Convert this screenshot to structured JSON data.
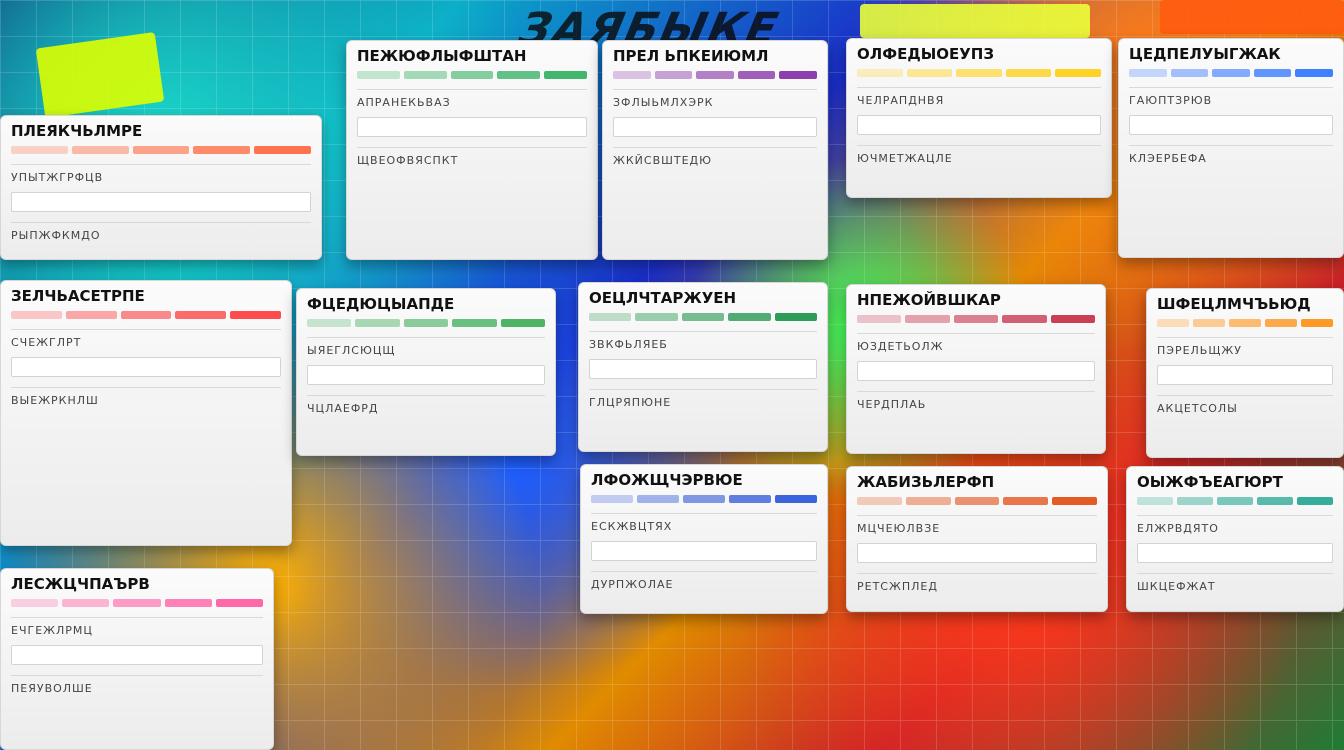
{
  "background": {
    "logo": "ЗАЯБЫКЕ"
  },
  "cards": [
    {
      "title": "ПЛЕЯКЧЬЛМРЕ",
      "line1": "УПЫТЖГРФЦВ",
      "line2": "РЫПЖФКМДО",
      "accent": "#ff5c2e"
    },
    {
      "title": "ПЕЖЮФЛЫФШТАН",
      "line1": "АПРАНЕКЬВАЗ",
      "line2": "ЩВЕОФВЯСПКТ",
      "accent": "#22aa55"
    },
    {
      "title": "ПРЕЛ ЬПКЕИЮМЛ",
      "line1": "ЗФЛЫЬМЛХЭРК",
      "line2": "ЖКЙСВШТЕДЮ",
      "accent": "#7a1ea0"
    },
    {
      "title": "ОЛФЕДЫОЕУПЗ",
      "line1": "ЧЕЛРАПДНВЯ",
      "line2": "ЮЧМЕТЖАЦЛЕ",
      "accent": "#ffcc00"
    },
    {
      "title": "ЦЕДПЕЛУЫГЖАК",
      "line1": "ГАЮПТЗРЮВ",
      "line2": "КЛЭЕРБЕФА",
      "accent": "#1f6cff"
    },
    {
      "title": "ЗЕЛЧЬАСЕТРПЕ",
      "line1": "СЧЕЖГЛРТ",
      "line2": "ВЫЕЖРКНЛШ",
      "accent": "#ff2e2e"
    },
    {
      "title": "ФЦЕДЮЦЫАПДЕ",
      "line1": "ЫЯЕГЛСЮЦЩ",
      "line2": "ЧЦЛАЕФРД",
      "accent": "#2ea84a"
    },
    {
      "title": "ОЕЦЛЧТАРЖУЕН",
      "line1": "ЗВКФЬЛЯЕБ",
      "line2": "ГЛЦРЯПЮНЕ",
      "accent": "#0a8c3a"
    },
    {
      "title": "НПЕЖОЙВШКАР",
      "line1": "ЮЗДЕТЬОЛЖ",
      "line2": "ЧЕРДПЛАЬ",
      "accent": "#c21e3a"
    },
    {
      "title": "ШФЕЦЛМЧЪЬЮД",
      "line1": "ПЭРЕЛЬЩЖУ",
      "line2": "АКЦЕТСОЛЫ",
      "accent": "#ff8800"
    },
    {
      "title": "ЛФОЖЩЧЭРВЮЕ",
      "line1": "ЕСКЖВЦТЯХ",
      "line2": "ДУРПЖОЛАЕ",
      "accent": "#1c4bd6"
    },
    {
      "title": "ЖАБИЗЬЛЕРФП",
      "line1": "МЦЧЕЮЛВЗЕ",
      "line2": "РЕТСЖПЛЕД",
      "accent": "#e04000"
    },
    {
      "title": "ОЫЖФЪЕАГЮРТ",
      "line1": "ЕЛЖРВДЯТО",
      "line2": "ШКЦЕФЖАТ",
      "accent": "#14a08a"
    },
    {
      "title": "ЛЕСЖЦЧПАЪРВ",
      "line1": "ЕЧГЕЖЛРМЦ",
      "line2": "ПЕЯУВОЛШЕ",
      "accent": "#ff4f9a"
    }
  ]
}
